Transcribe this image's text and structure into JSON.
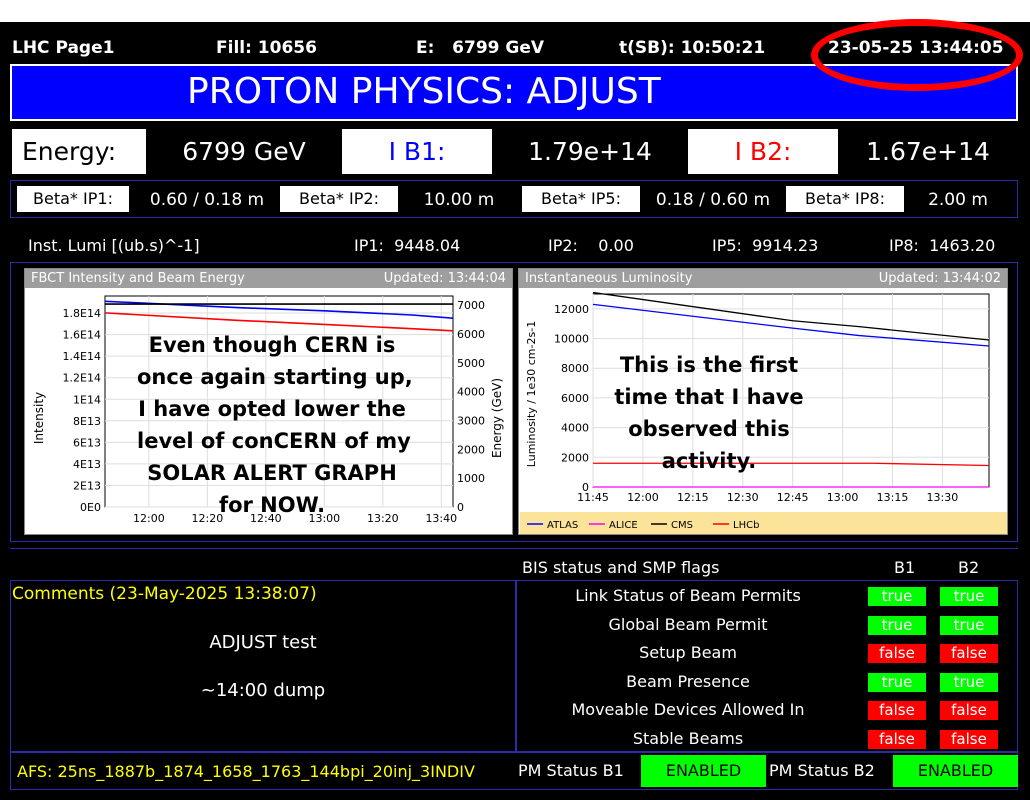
{
  "header": {
    "page": "LHC Page1",
    "fill": "Fill: 10656",
    "energy": "E:   6799 GeV",
    "time_sb": "t(SB): 10:50:21",
    "datetime": "23-05-25 13:44:05"
  },
  "mode": "PROTON PHYSICS: ADJUST",
  "energy_row": {
    "energy_label": "Energy:",
    "energy_value": "6799 GeV",
    "ib1_label": "I B1:",
    "ib1_value": "1.79e+14",
    "ib2_label": "I B2:",
    "ib2_value": "1.67e+14"
  },
  "beta": [
    {
      "label": "Beta* IP1:",
      "value": "0.60 / 0.18 m"
    },
    {
      "label": "Beta* IP2:",
      "value": "10.00 m"
    },
    {
      "label": "Beta* IP5:",
      "value": "0.18 / 0.60 m"
    },
    {
      "label": "Beta* IP8:",
      "value": "2.00 m"
    }
  ],
  "lumi": {
    "label": "Inst. Lumi [(ub.s)^-1]",
    "ip1": "IP1:  9448.04",
    "ip2": "IP2:    0.00",
    "ip5": "IP5:  9914.23",
    "ip8": "IP8:  1463.20"
  },
  "chart_data": [
    {
      "type": "line",
      "title": "FBCT Intensity and Beam Energy",
      "updated": "Updated: 13:44:04",
      "ylabel": "Intensity",
      "y2label": "Energy (GeV)",
      "yticks": [
        "0E0",
        "2E13",
        "4E13",
        "6E13",
        "8E13",
        "1E14",
        "1.2E14",
        "1.4E14",
        "1.6E14",
        "1.8E14"
      ],
      "y2ticks": [
        "0",
        "1000",
        "2000",
        "3000",
        "4000",
        "5000",
        "6000",
        "7000"
      ],
      "xticks": [
        "12:00",
        "12:20",
        "12:40",
        "13:00",
        "13:20",
        "13:40"
      ],
      "ylim": [
        0,
        200000000000000.0
      ],
      "y2lim": [
        0,
        7000
      ],
      "series": [
        {
          "color": "#0000ff",
          "x": [
            "11:45",
            "12:30",
            "13:00",
            "13:30",
            "13:44"
          ],
          "values": [
            195000000000000.0,
            189000000000000.0,
            186000000000000.0,
            182000000000000.0,
            179000000000000.0
          ]
        },
        {
          "color": "#ff0000",
          "x": [
            "11:45",
            "12:30",
            "13:00",
            "13:30",
            "13:44"
          ],
          "values": [
            184000000000000.0,
            177000000000000.0,
            173000000000000.0,
            169000000000000.0,
            167000000000000.0
          ]
        },
        {
          "color": "#000000",
          "axis": "y2",
          "x": [
            "11:45",
            "13:44"
          ],
          "values": [
            6799,
            6799
          ]
        }
      ],
      "annotation": "Even though CERN is\nonce again starting up,\nI have opted lower the\nlevel of conCERN of my\nSOLAR ALERT GRAPH\nfor NOW."
    },
    {
      "type": "line",
      "title": "Instantaneous Luminosity",
      "updated": "Updated: 13:44:02",
      "ylabel": "Luminosity / 1e30 cm-2s-1",
      "yticks": [
        "0",
        "2000",
        "4000",
        "6000",
        "8000",
        "10000",
        "12000"
      ],
      "xticks": [
        "11:45",
        "12:00",
        "12:15",
        "12:30",
        "12:45",
        "13:00",
        "13:15",
        "13:30"
      ],
      "ylim": [
        0,
        13000
      ],
      "legend": [
        "ATLAS",
        "ALICE",
        "CMS",
        "LHCb"
      ],
      "series": [
        {
          "name": "ATLAS",
          "color": "#0000ff",
          "x": [
            "11:45",
            "12:45",
            "13:05",
            "13:44"
          ],
          "values": [
            12300,
            10700,
            10200,
            9500
          ]
        },
        {
          "name": "ALICE",
          "color": "#ff00ff",
          "x": [
            "11:45",
            "13:44"
          ],
          "values": [
            0,
            0
          ]
        },
        {
          "name": "CMS",
          "color": "#000000",
          "x": [
            "11:45",
            "12:45",
            "13:05",
            "13:44"
          ],
          "values": [
            13100,
            11200,
            10800,
            9900
          ]
        },
        {
          "name": "LHCb",
          "color": "#ff0000",
          "x": [
            "11:45",
            "13:09",
            "13:44"
          ],
          "values": [
            1600,
            1600,
            1450
          ]
        }
      ],
      "annotation": "This is the first\ntime that I have\nobserved this\nactivity."
    }
  ],
  "comments": {
    "header": "Comments (23-May-2025 13:38:07)",
    "line1": "ADJUST test",
    "line2": "~14:00 dump"
  },
  "bis": {
    "title": "BIS status and SMP flags",
    "col_b1": "B1",
    "col_b2": "B2",
    "rows": [
      {
        "label": "Link Status of Beam Permits",
        "b1": "true",
        "b2": "true"
      },
      {
        "label": "Global Beam Permit",
        "b1": "true",
        "b2": "true"
      },
      {
        "label": "Setup Beam",
        "b1": "false",
        "b2": "false"
      },
      {
        "label": "Beam Presence",
        "b1": "true",
        "b2": "true"
      },
      {
        "label": "Moveable Devices Allowed In",
        "b1": "false",
        "b2": "false"
      },
      {
        "label": "Stable Beams",
        "b1": "false",
        "b2": "false"
      }
    ]
  },
  "footer": {
    "afs": "AFS: 25ns_1887b_1874_1658_1763_144bpi_20inj_3INDIV",
    "pm_b1_label": "PM Status B1",
    "pm_b1_value": "ENABLED",
    "pm_b2_label": "PM Status B2",
    "pm_b2_value": "ENABLED"
  },
  "colors": {
    "banner_blue": "#0000ff",
    "ok_green": "#00ff00",
    "fail_red": "#ff0000",
    "comment_yellow": "#ffff00",
    "annotation_circle": "#ff0000"
  }
}
